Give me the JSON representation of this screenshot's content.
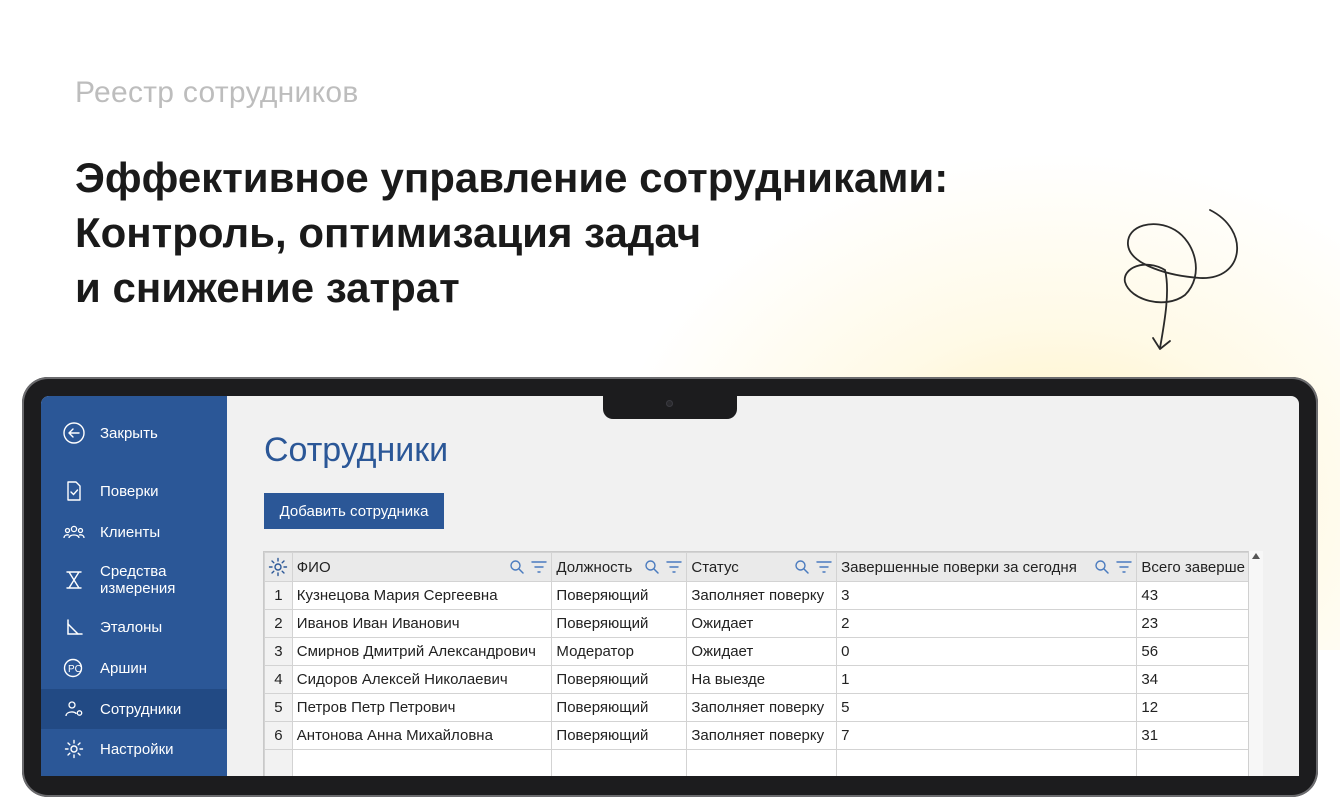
{
  "hero": {
    "eyebrow": "Реестр сотрудников",
    "headline": [
      "Эффективное управление сотрудниками:",
      "Контроль, оптимизация задач",
      "и снижение затрат"
    ]
  },
  "colors": {
    "sidebar": "#2b5797",
    "accent": "#2b5797",
    "highlight": "#ffe9a0"
  },
  "sidebar": {
    "items": [
      {
        "label": "Закрыть",
        "icon": "back-arrow-icon"
      },
      {
        "label": "Поверки",
        "icon": "document-check-icon"
      },
      {
        "label": "Клиенты",
        "icon": "users-icon"
      },
      {
        "label": "Средства измерения",
        "icon": "hourglass-icon"
      },
      {
        "label": "Эталоны",
        "icon": "ruler-triangle-icon"
      },
      {
        "label": "Аршин",
        "icon": "arshin-logo-icon"
      },
      {
        "label": "Сотрудники",
        "icon": "employee-settings-icon"
      },
      {
        "label": "Настройки",
        "icon": "gear-icon"
      }
    ],
    "active": "Сотрудники"
  },
  "main": {
    "title": "Сотрудники",
    "add_button": "Добавить сотрудника"
  },
  "table": {
    "columns": [
      "ФИО",
      "Должность",
      "Статус",
      "Завершенные поверки за сегодня",
      "Всего заверше"
    ],
    "rows": [
      {
        "n": "1",
        "fio": "Кузнецова Мария Сергеевна",
        "role": "Поверяющий",
        "status": "Заполняет поверку",
        "today": "3",
        "total": "43"
      },
      {
        "n": "2",
        "fio": "Иванов Иван Иванович",
        "role": "Поверяющий",
        "status": "Ожидает",
        "today": "2",
        "total": "23"
      },
      {
        "n": "3",
        "fio": "Смирнов Дмитрий Александрович",
        "role": "Модератор",
        "status": "Ожидает",
        "today": "0",
        "total": "56"
      },
      {
        "n": "4",
        "fio": "Сидоров Алексей Николаевич",
        "role": "Поверяющий",
        "status": "На выезде",
        "today": "1",
        "total": "34"
      },
      {
        "n": "5",
        "fio": "Петров Петр Петрович",
        "role": "Поверяющий",
        "status": "Заполняет поверку",
        "today": "5",
        "total": "12"
      },
      {
        "n": "6",
        "fio": "Антонова Анна Михайловна",
        "role": "Поверяющий",
        "status": "Заполняет поверку",
        "today": "7",
        "total": "31"
      }
    ]
  }
}
